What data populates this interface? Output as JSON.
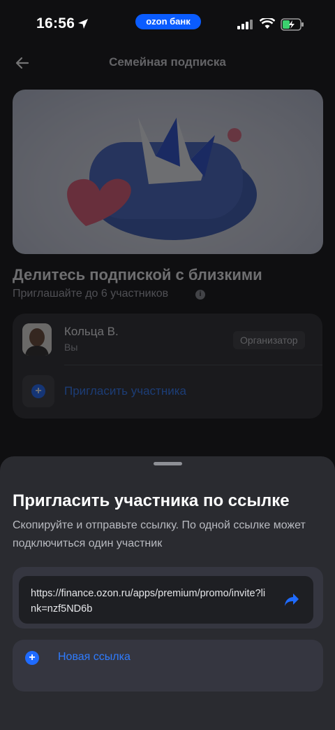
{
  "status": {
    "time": "16:56",
    "pill_label": "ozon банк"
  },
  "nav": {
    "title": "Семейная подписка",
    "back_icon": "arrow-left-icon"
  },
  "page": {
    "heading": "Делитесь подпиской с близкими",
    "subheading": "Приглашайте до 6 участников"
  },
  "members": {
    "items": [
      {
        "name": "Кольца В.",
        "sub": "Вы",
        "role": "Организатор"
      }
    ],
    "invite_label": "Пригласить участника"
  },
  "sheet": {
    "title": "Пригласить участника по ссылке",
    "description": "Скопируйте и отправьте ссылку. По одной ссылке может подключиться один участник",
    "link": "https://finance.ozon.ru/apps/premium/promo/invite?link=nzf5ND6b",
    "share_icon": "share-arrow-icon",
    "new_link_label": "Новая ссылка"
  },
  "colors": {
    "accent": "#1f6bff",
    "pill": "#0a5cff",
    "sheet_bg": "#2a2b30"
  }
}
